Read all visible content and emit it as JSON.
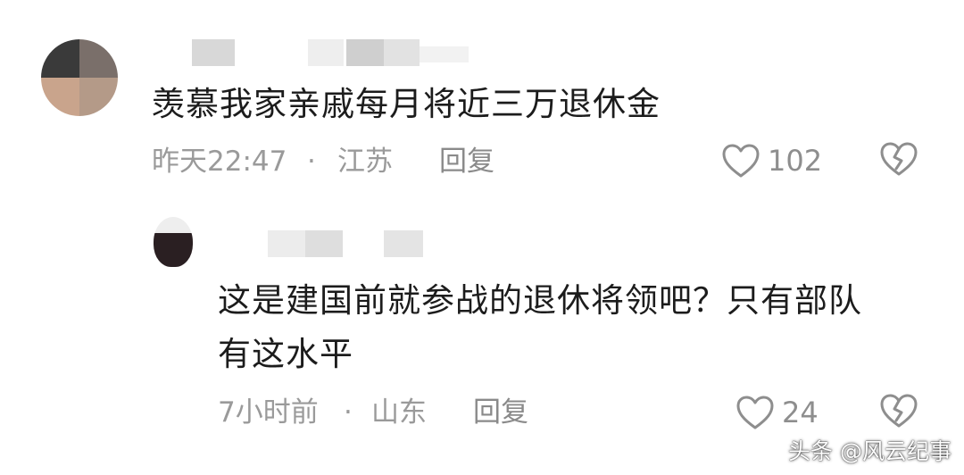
{
  "comments": [
    {
      "text": "羡慕我家亲戚每月将近三万退休金",
      "time": "昨天22:47",
      "sep": "·",
      "location": "江苏",
      "reply_label": "回复",
      "like_count": "102"
    },
    {
      "text_line1": "这是建国前就参战的退休将领吧？只有部队",
      "text_line2": "有这水平",
      "time": "7小时前",
      "sep": "·",
      "location": "山东",
      "reply_label": "回复",
      "like_count": "24"
    }
  ],
  "watermark": "头条 @风云纪事",
  "colors": {
    "meta": "#9a9a9a",
    "icon": "#8e8e8e",
    "text": "#1c1c1c"
  },
  "icons": [
    "heart-icon",
    "broken-heart-icon"
  ]
}
